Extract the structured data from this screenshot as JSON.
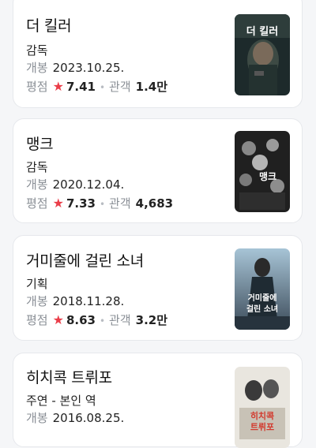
{
  "movies": [
    {
      "title": "더 킬러",
      "role": "감독",
      "release_label": "개봉",
      "release_date": "2023.10.25.",
      "rating_label": "평점",
      "rating": "7.41",
      "audience_label": "관객",
      "audience": "1.4만",
      "poster_text": "더 킬러"
    },
    {
      "title": "맹크",
      "role": "감독",
      "release_label": "개봉",
      "release_date": "2020.12.04.",
      "rating_label": "평점",
      "rating": "7.33",
      "audience_label": "관객",
      "audience": "4,683",
      "poster_text": "맹크"
    },
    {
      "title": "거미줄에 걸린 소녀",
      "role": "기획",
      "release_label": "개봉",
      "release_date": "2018.11.28.",
      "rating_label": "평점",
      "rating": "8.63",
      "audience_label": "관객",
      "audience": "3.2만",
      "poster_text_1": "거미줄에",
      "poster_text_2": "걸린 소녀"
    },
    {
      "title": "히치콕 트뤼포",
      "role": "주연 - 본인 역",
      "release_label": "개봉",
      "release_date": "2016.08.25.",
      "poster_text_1": "히치콕",
      "poster_text_2": "트뤼포"
    }
  ],
  "colors": {
    "star": "#ea3d49",
    "label": "#8a8f96",
    "card_border": "#e6e8ec"
  },
  "icons": {
    "rating": "star-icon",
    "separator": "dot-icon"
  }
}
